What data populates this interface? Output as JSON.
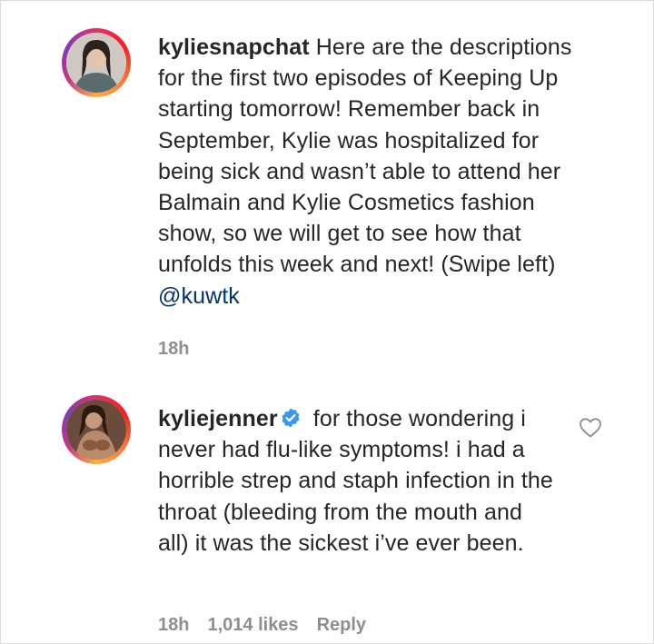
{
  "comments": [
    {
      "username": "kyliesnapchat",
      "text": "Here are the descriptions for the first two episodes of Keeping Up starting tomorrow! Remember back in September, Kylie was hospitalized for being sick and wasn’t able to attend her Balmain and Kylie Cosmetics fashion show, so we will get to see how that unfolds this week and next! (Swipe left)",
      "mention": "@kuwtk",
      "time": "18h"
    },
    {
      "username": "kyliejenner",
      "verified": true,
      "text": "for those wondering i never had flu-like symptoms! i had a horrible strep and staph infection in the throat (bleeding from the mouth and all) it was the sickest i’ve ever been.",
      "time": "18h",
      "likes": "1,014 likes",
      "reply": "Reply"
    }
  ],
  "colors": {
    "text": "#262626",
    "meta": "#8e8e8e",
    "mention": "#003569",
    "verified": "#3897f0"
  }
}
